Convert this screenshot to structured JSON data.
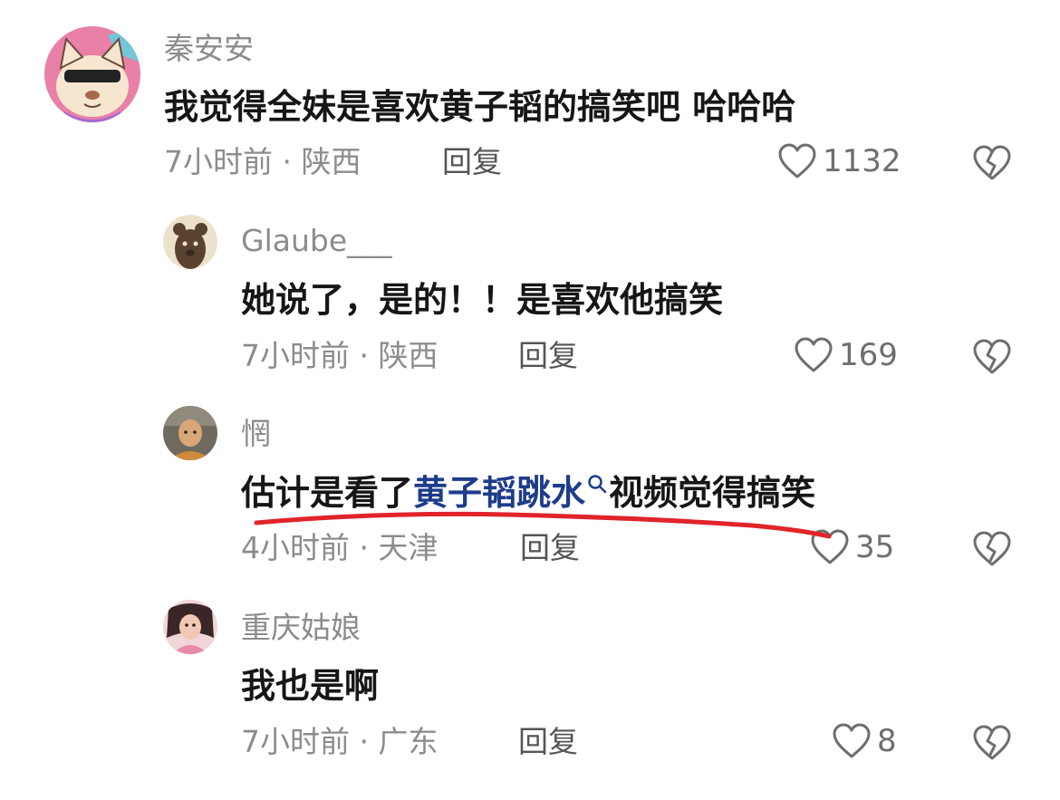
{
  "comments": [
    {
      "username": "秦安安",
      "text": "我觉得全妹是喜欢黄子韬的搞笑吧 哈哈哈",
      "time_location": "7小时前 · 陕西",
      "reply_label": "回复",
      "likes": "1132"
    },
    {
      "username": "Glaube___",
      "text": "她说了，是的！！是喜欢他搞笑",
      "time_location": "7小时前 · 陕西",
      "reply_label": "回复",
      "likes": "169"
    },
    {
      "username": "惘",
      "text_before": "估计是看了",
      "text_link": "黄子韬跳水",
      "text_after": "视频觉得搞笑",
      "time_location": "4小时前 · 天津",
      "reply_label": "回复",
      "likes": "35"
    },
    {
      "username": "重庆姑娘",
      "text": "我也是啊",
      "time_location": "7小时前 · 广东",
      "reply_label": "回复",
      "likes": "8"
    }
  ],
  "icons": {
    "like": "heart-outline-icon",
    "dislike": "broken-heart-icon",
    "search": "search-icon"
  },
  "colors": {
    "link": "#1d3c8c",
    "annotation_underline": "#e0242a"
  }
}
